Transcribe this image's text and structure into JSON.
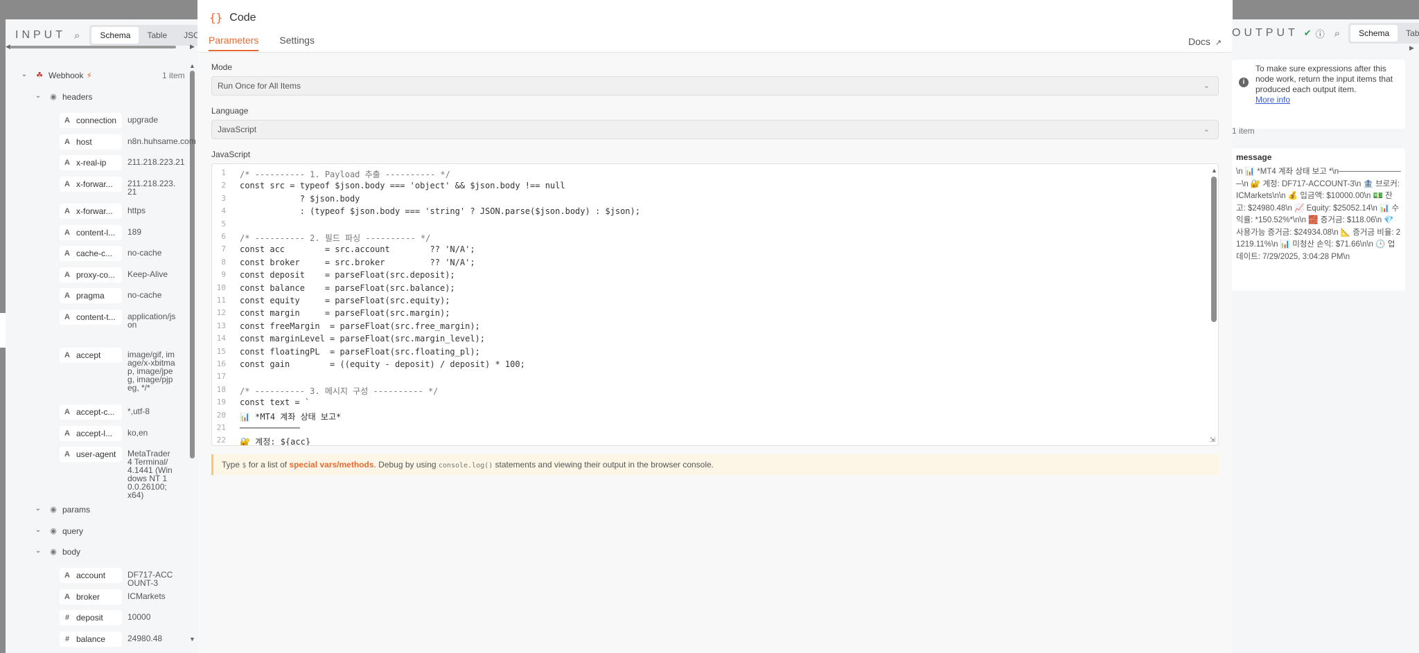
{
  "input_panel": {
    "title": "INPUT",
    "tabs": [
      "Schema",
      "Table",
      "JSON"
    ],
    "active_tab": 0,
    "root": {
      "label": "Webhook",
      "count": "1 item"
    },
    "groups": [
      {
        "label": "headers",
        "fields": [
          {
            "name": "connection",
            "value": "upgrade",
            "type": "A"
          },
          {
            "name": "host",
            "value": "n8n.huhsame.com",
            "type": "A"
          },
          {
            "name": "x-real-ip",
            "value": "211.218.223.21",
            "type": "A"
          },
          {
            "name": "x-forwar...",
            "value": "211.218.223.21",
            "type": "A"
          },
          {
            "name": "x-forwar...",
            "value": "https",
            "type": "A"
          },
          {
            "name": "content-l...",
            "value": "189",
            "type": "A"
          },
          {
            "name": "cache-c...",
            "value": "no-cache",
            "type": "A"
          },
          {
            "name": "proxy-co...",
            "value": "Keep-Alive",
            "type": "A"
          },
          {
            "name": "pragma",
            "value": "no-cache",
            "type": "A"
          },
          {
            "name": "content-t...",
            "value": "application/json",
            "type": "A"
          },
          {
            "name": "accept",
            "value": "image/gif, image/x-xbitmap, image/jpeg, image/pjpeg, */*",
            "type": "A"
          },
          {
            "name": "accept-c...",
            "value": "*,utf-8",
            "type": "A"
          },
          {
            "name": "accept-l...",
            "value": "ko,en",
            "type": "A"
          },
          {
            "name": "user-agent",
            "value": "MetaTrader 4 Terminal/4.1441 (Windows NT 10.0.26100; x64)",
            "type": "A"
          }
        ]
      },
      {
        "label": "params",
        "fields": []
      },
      {
        "label": "query",
        "fields": []
      },
      {
        "label": "body",
        "fields": [
          {
            "name": "account",
            "value": "DF717-ACCOUNT-3",
            "type": "A"
          },
          {
            "name": "broker",
            "value": "ICMarkets",
            "type": "A"
          },
          {
            "name": "deposit",
            "value": "10000",
            "type": "#"
          },
          {
            "name": "balance",
            "value": "24980.48",
            "type": "#"
          }
        ]
      }
    ]
  },
  "modal": {
    "title": "Code",
    "tabs": [
      "Parameters",
      "Settings"
    ],
    "docs_label": "Docs",
    "mode_label": "Mode",
    "mode_value": "Run Once for All Items",
    "language_label": "Language",
    "language_value": "JavaScript",
    "editor_label": "JavaScript",
    "code_lines": [
      "/* ---------- 1. Payload 추출 ---------- */",
      "const src = typeof $json.body === 'object' && $json.body !== null",
      "            ? $json.body",
      "            : (typeof $json.body === 'string' ? JSON.parse($json.body) : $json);",
      "",
      "/* ---------- 2. 필드 파싱 ---------- */",
      "const acc        = src.account        ?? 'N/A';",
      "const broker     = src.broker         ?? 'N/A';",
      "const deposit    = parseFloat(src.deposit);",
      "const balance    = parseFloat(src.balance);",
      "const equity     = parseFloat(src.equity);",
      "const margin     = parseFloat(src.margin);",
      "const freeMargin  = parseFloat(src.free_margin);",
      "const marginLevel = parseFloat(src.margin_level);",
      "const floatingPL  = parseFloat(src.floating_pl);",
      "const gain        = ((equity - deposit) / deposit) * 100;",
      "",
      "/* ---------- 3. 메시지 구성 ---------- */",
      "const text = `",
      "📊 *MT4 계좌 상태 보고*",
      "────────────",
      "🔐 계정: ${acc}"
    ],
    "hint": {
      "pre": "Type ",
      "dollar": "$",
      "mid": " for a list of ",
      "accent": "special vars/methods",
      "post1": ". Debug by using ",
      "code": "console.log()",
      "post2": " statements and viewing their output in the browser console."
    }
  },
  "output_panel": {
    "title": "OUTPUT",
    "tabs": [
      "Schema",
      "Table"
    ],
    "active_tab": 0,
    "notice": "To make sure expressions after this node work, return the input items that produced each output item.",
    "notice_link": "More info",
    "count": "1 item",
    "card_key": "message",
    "card_value": "\\n 📊 *MT4 계좌 상태 보고 *\\n────────────\\n 🔐 계정: DF717-ACCOUNT-3\\n 🏦 브로커: ICMarkets\\n\\n 💰 입금액: $10000.00\\n 💵 잔고: $24980.48\\n 📈 Equity: $25052.14\\n 📊 수익률: *150.52%*\\n\\n 🧱 증거금: $118.06\\n 💎 사용가능 증거금: $24934.08\\n 📐 증거금 비율: 21219.11%\\n 📊 미청산 손익: $71.66\\n\\n 🕒 업데이트: 7/29/2025, 3:04:28 PM\\n"
  },
  "colors": {
    "accent": "#e86a33",
    "ok": "#2e9b5f",
    "link": "#3b5bdb"
  },
  "icons": {
    "search": "search-icon",
    "code": "braces-icon",
    "external": "external-link-icon",
    "chevron": "chevron-down-icon",
    "info": "info-icon",
    "success": "check-circle-icon",
    "webhook": "webhook-icon",
    "bolt": "bolt-icon"
  }
}
